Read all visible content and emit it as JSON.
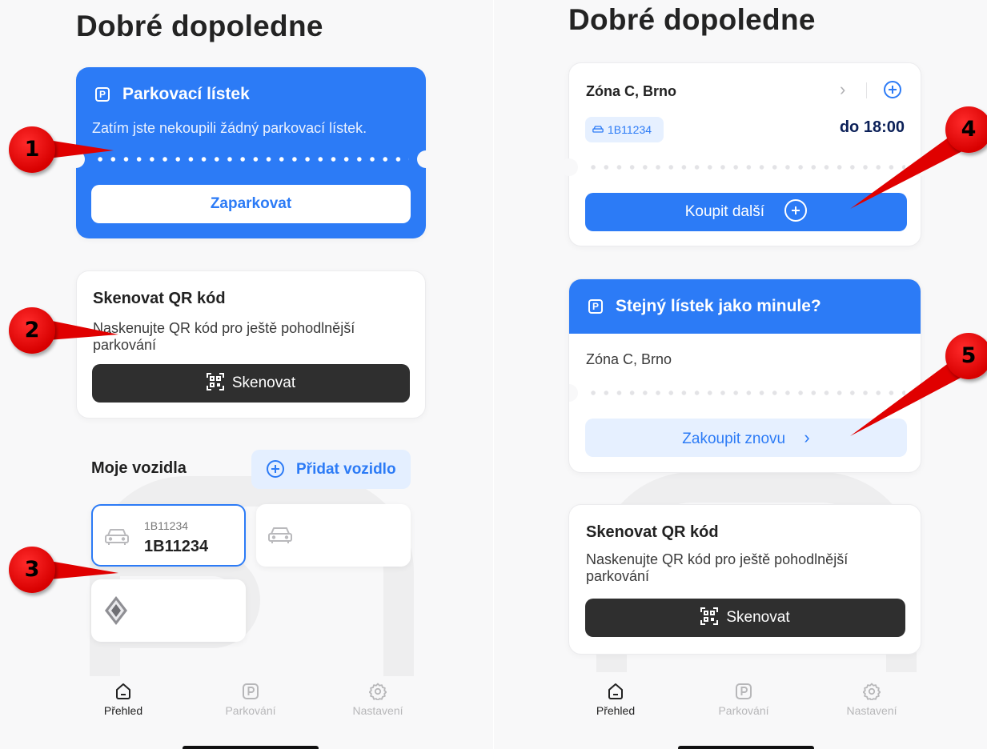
{
  "left_screen": {
    "greeting": "Dobré dopoledne",
    "parking_ticket": {
      "icon": "parking-icon",
      "title": "Parkovací lístek",
      "subtitle": "Zatím jste nekoupili žádný parkovací lístek.",
      "button": "Zaparkovat"
    },
    "scan": {
      "title": "Skenovat QR kód",
      "description": "Naskenujte QR kód pro ještě pohodlnější parkování",
      "button": "Skenovat",
      "button_icon": "qr-code-icon"
    },
    "vehicles": {
      "title": "Moje vozidla",
      "add_button": "Přidat vozidlo",
      "items": [
        {
          "small": "1B11234",
          "plate": "1B11234",
          "icon": "car-icon",
          "selected": true
        },
        {
          "small": "",
          "plate": "",
          "icon": "car-icon",
          "selected": false
        },
        {
          "small": "",
          "plate": "",
          "icon": "renault-logo",
          "selected": false
        }
      ]
    },
    "tabs": [
      {
        "label": "Přehled",
        "icon": "home-icon",
        "active": true
      },
      {
        "label": "Parkování",
        "icon": "parking-icon",
        "active": false
      },
      {
        "label": "Nastavení",
        "icon": "gear-icon",
        "active": false
      }
    ]
  },
  "right_screen": {
    "greeting": "Dobré dopoledne",
    "active_ticket": {
      "zone": "Zóna C, Brno",
      "plate": "1B11234",
      "until": "do 18:00",
      "button": "Koupit další"
    },
    "repeat": {
      "title": "Stejný lístek jako minule?",
      "zone": "Zóna C, Brno",
      "button": "Zakoupit znovu"
    },
    "scan": {
      "title": "Skenovat QR kód",
      "description": "Naskenujte QR kód pro ještě pohodlnější parkování",
      "button": "Skenovat"
    },
    "tabs": [
      {
        "label": "Přehled",
        "icon": "home-icon",
        "active": true
      },
      {
        "label": "Parkování",
        "icon": "parking-icon",
        "active": false
      },
      {
        "label": "Nastavení",
        "icon": "gear-icon",
        "active": false
      }
    ]
  },
  "annotations": [
    "1",
    "2",
    "3",
    "4",
    "5"
  ],
  "colors": {
    "accent": "#2c7bf6",
    "accent_light": "#e4efff",
    "dark_button": "#2f2f2f",
    "marker": "#e00000",
    "time_text": "#0b2058"
  }
}
